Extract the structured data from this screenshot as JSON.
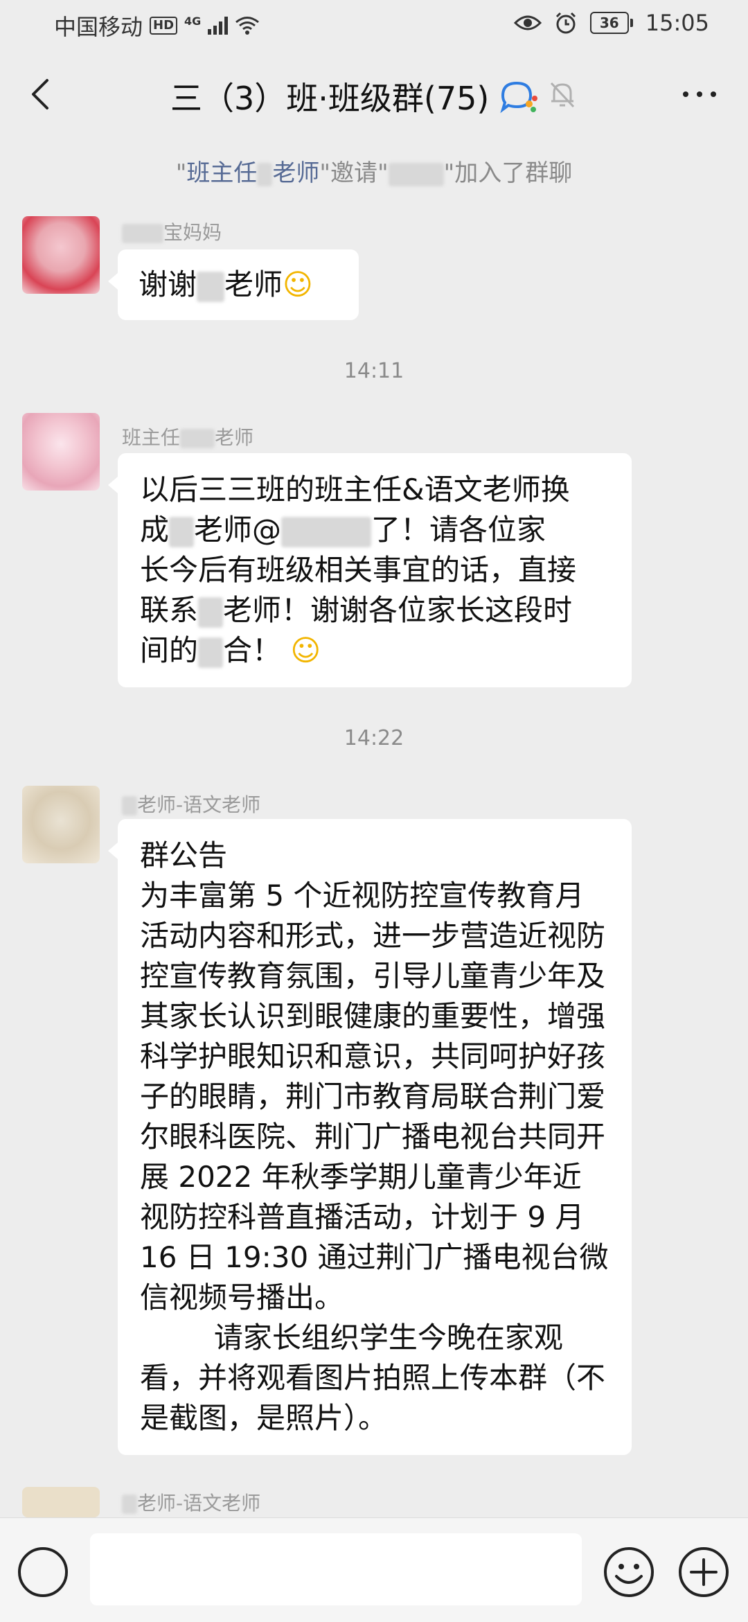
{
  "status_bar": {
    "carrier": "中国移动",
    "hd_badge": "HD",
    "network": "4G",
    "battery": "36",
    "time": "15:05"
  },
  "nav": {
    "title": "三（3）班·班级群(75)"
  },
  "system_notice": {
    "quote_open": "\"",
    "inviter": "班主任",
    "inviter_suffix": "老师",
    "verb": "\"邀请\"",
    "joined": "\"加入了群聊"
  },
  "messages": [
    {
      "sender": "宝妈妈",
      "text": "谢谢",
      "text_suffix": "老师",
      "emoji": "☺"
    },
    {
      "time": "14:11"
    },
    {
      "sender": "班主任",
      "sender_suffix": "老师",
      "lines": [
        "以后三三班的班主任&语文老师换",
        "成",
        "老师@",
        "了！请各位家",
        "长今后有班级相关事宜的话，直接",
        "联系",
        "老师！谢谢各位家长这段时",
        "间的",
        "合！"
      ],
      "emoji": "☺"
    },
    {
      "time": "14:22"
    },
    {
      "sender": "老师-语文老师",
      "text": "群公告\n为丰富第 5 个近视防控宣传教育月活动内容和形式，进一步营造近视防控宣传教育氛围，引导儿童青少年及其家长认识到眼健康的重要性，增强科学护眼知识和意识，共同呵护好孩子的眼睛，荆门市教育局联合荆门爱尔眼科医院、荆门广播电视台共同开展 2022 年秋季学期儿童青少年近视防控科普直播活动，计划于 9 月 16 日 19:30 通过荆门广播电视台微信视频号播出。\n        请家长组织学生今晚在家观看，并将观看图片拍照上传本群（不是截图，是照片）。"
    },
    {
      "sender": "老师-语文老师"
    }
  ],
  "colors": {
    "background": "#ededed",
    "link": "#576b95",
    "bubble": "#ffffff"
  }
}
